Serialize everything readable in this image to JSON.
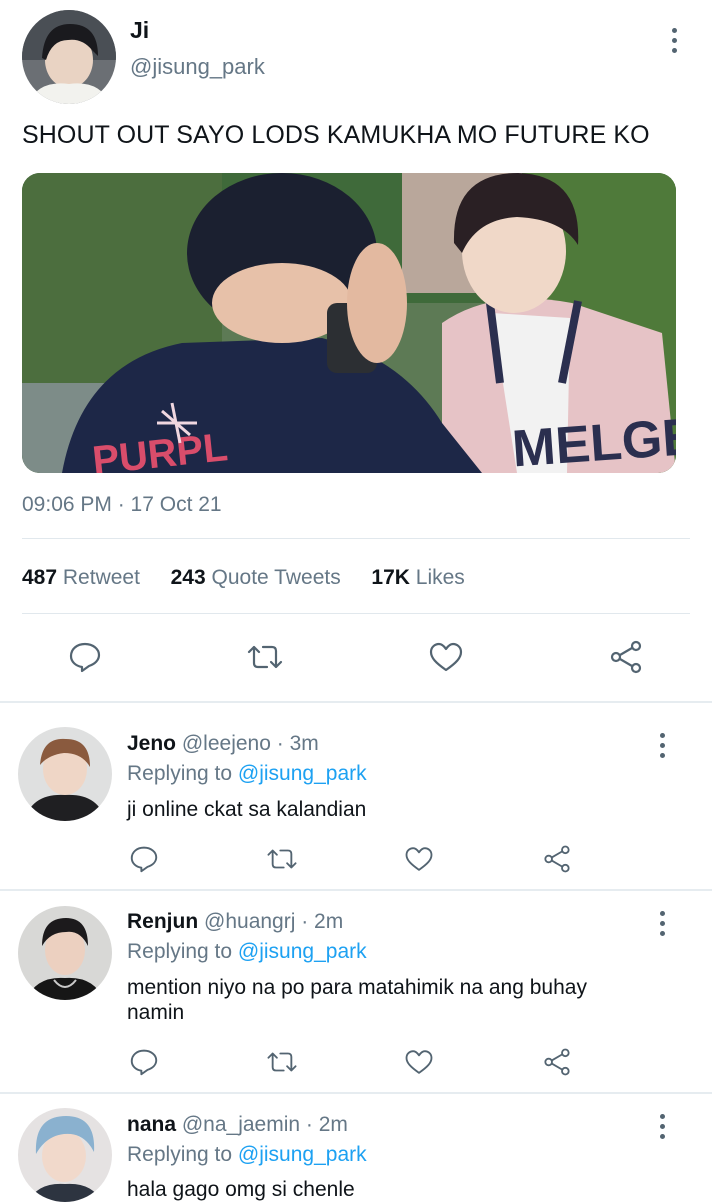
{
  "tweet": {
    "author_name": "Ji",
    "author_handle": "@jisung_park",
    "text": "SHOUT OUT SAYO LODS KAMUKHA MO FUTURE KO",
    "timestamp": "09:06 PM · 17 Oct 21",
    "stats": {
      "retweets_count": "487",
      "retweets_label": "Retweet",
      "quotes_count": "243",
      "quotes_label": "Quote Tweets",
      "likes_count": "17K",
      "likes_label": "Likes"
    }
  },
  "replies": [
    {
      "name": "Jeno",
      "handle": "@leejeno",
      "time": "· 3m",
      "replying_prefix": "Replying to",
      "replying_to": "@jisung_park",
      "text": "ji online ckat sa kalandian"
    },
    {
      "name": "Renjun",
      "handle": "@huangrj",
      "time": "· 2m",
      "replying_prefix": "Replying to",
      "replying_to": "@jisung_park",
      "text": "mention niyo na po para matahimik na ang buhay namin"
    },
    {
      "name": "nana",
      "handle": "@na_jaemin",
      "time": "· 2m",
      "replying_prefix": "Replying to",
      "replying_to": "@jisung_park",
      "text": "hala gago omg si chenle"
    }
  ],
  "media": {
    "jacket_text": "MELGE",
    "jacket_text_left": "PURPL"
  },
  "colors": {
    "link": "#1da1f2",
    "muted": "#657786",
    "icon": "#536471",
    "divider": "#e1e8ed"
  },
  "icons": [
    "more-vertical-icon",
    "reply-icon",
    "retweet-icon",
    "like-icon",
    "share-icon"
  ]
}
